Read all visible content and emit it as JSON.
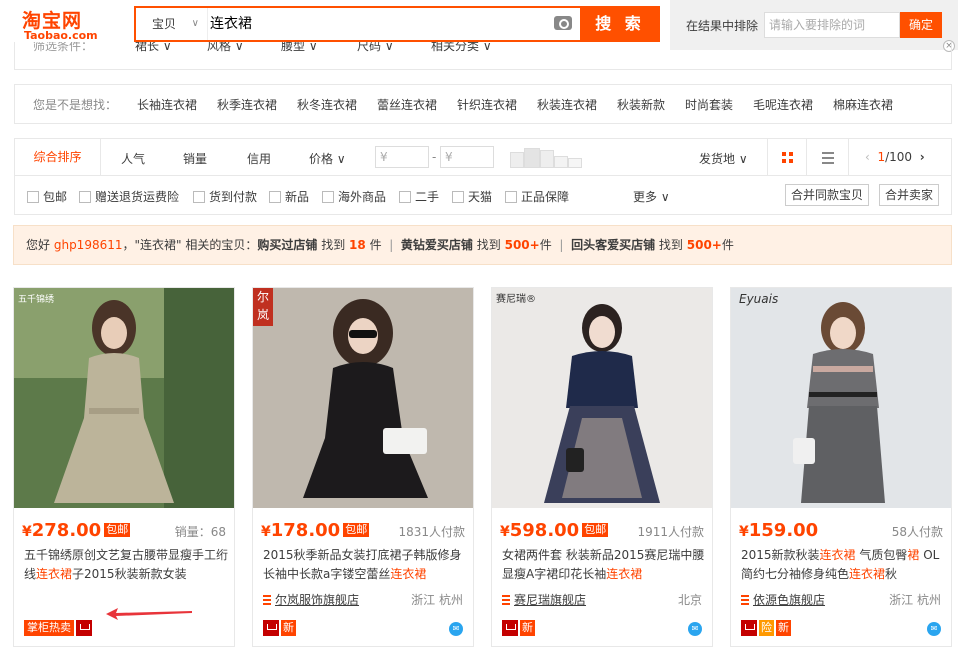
{
  "header": {
    "logo_cn": "淘宝网",
    "logo_en": "Taobao.com",
    "search_scope": "宝贝",
    "search_query": "连衣裙",
    "search_button": "搜 索",
    "exclude_label": "在结果中排除",
    "exclude_placeholder": "请输入要排除的词",
    "exclude_button": "确定",
    "close_symbol": "×"
  },
  "filter_bar": {
    "label": "筛选条件：",
    "items": [
      "裙长",
      "风格",
      "腰型",
      "尺码",
      "相关分类"
    ]
  },
  "suggestions": {
    "label": "您是不是想找：",
    "items": [
      "长袖连衣裙",
      "秋季连衣裙",
      "秋冬连衣裙",
      "蕾丝连衣裙",
      "针织连衣裙",
      "秋装连衣裙",
      "秋装新款",
      "时尚套装",
      "毛呢连衣裙",
      "棉麻连衣裙"
    ]
  },
  "sort_bar": {
    "active": "综合排序",
    "tabs": [
      "人气",
      "销量",
      "信用"
    ],
    "price_label": "价格",
    "price_min_placeholder": "¥",
    "price_max_placeholder": "¥",
    "price_dash": "-",
    "ship_from": "发货地",
    "page_current": "1",
    "page_total": "/100"
  },
  "check_bar": {
    "items": [
      "包邮",
      "赠送退货运费险",
      "货到付款",
      "新品",
      "海外商品",
      "二手",
      "天猫",
      "正品保障"
    ],
    "more": "更多",
    "merge_same": "合并同款宝贝",
    "merge_seller": "合并卖家"
  },
  "notice": {
    "greet": "您好",
    "username": "ghp198611",
    "text1": "，\"连衣裙\" 相关的宝贝：",
    "bought": "购买过店铺",
    "found": "找到",
    "count1": "18",
    "unit": "件",
    "sep": "|",
    "diamond": "黄钻爱买店铺",
    "count2": "500+",
    "repeat": "回头客爱买店铺",
    "count3": "500+"
  },
  "products": [
    {
      "price": "278.00",
      "yen": "¥",
      "baoyou": "包邮",
      "sales": "销量：68",
      "title_pre": "五千锦绣原创文艺复古腰带显瘦手工绗线",
      "title_hl": "连衣裙",
      "title_post": "子2015秋装新款女装",
      "shop": "",
      "location": "",
      "badge_hot": "掌柜热卖",
      "img_label": "五千锦绣",
      "bg": "#6f8a5a"
    },
    {
      "price": "178.00",
      "yen": "¥",
      "baoyou": "包邮",
      "sales": "1831人付款",
      "title_pre": "2015秋季新品女装打底裙子韩版修身长袖中长款a字镂空蕾丝",
      "title_hl": "连衣裙",
      "title_post": "",
      "shop": "尔岚服饰旗舰店",
      "location": "浙江 杭州",
      "badge_new": "新",
      "img_label": "尔岚",
      "bg": "#b7b0a8"
    },
    {
      "price": "598.00",
      "yen": "¥",
      "baoyou": "包邮",
      "sales": "1911人付款",
      "title_pre": "女裙两件套 秋装新品2015赛尼瑞中腰显瘦A字裙印花长袖",
      "title_hl": "连衣裙",
      "title_post": "",
      "shop": "赛尼瑞旗舰店",
      "location": "北京",
      "badge_new": "新",
      "img_label": "赛尼瑞®",
      "bg": "#e8e6e4"
    },
    {
      "price": "159.00",
      "yen": "¥",
      "baoyou": "",
      "sales": "58人付款",
      "title_pre": "2015新款秋装",
      "title_hl": "连衣裙",
      "title_mid": " 气质包臀",
      "title_hl2": "裙",
      "title_post": " OL简约七分袖修身纯色",
      "title_hl3": "连衣裙",
      "title_post2": "秋",
      "shop": "依源色旗舰店",
      "location": "浙江 杭州",
      "badge_gold": "险",
      "badge_new": "新",
      "img_label": "Eyuais",
      "bg": "#dfe3e6"
    }
  ]
}
